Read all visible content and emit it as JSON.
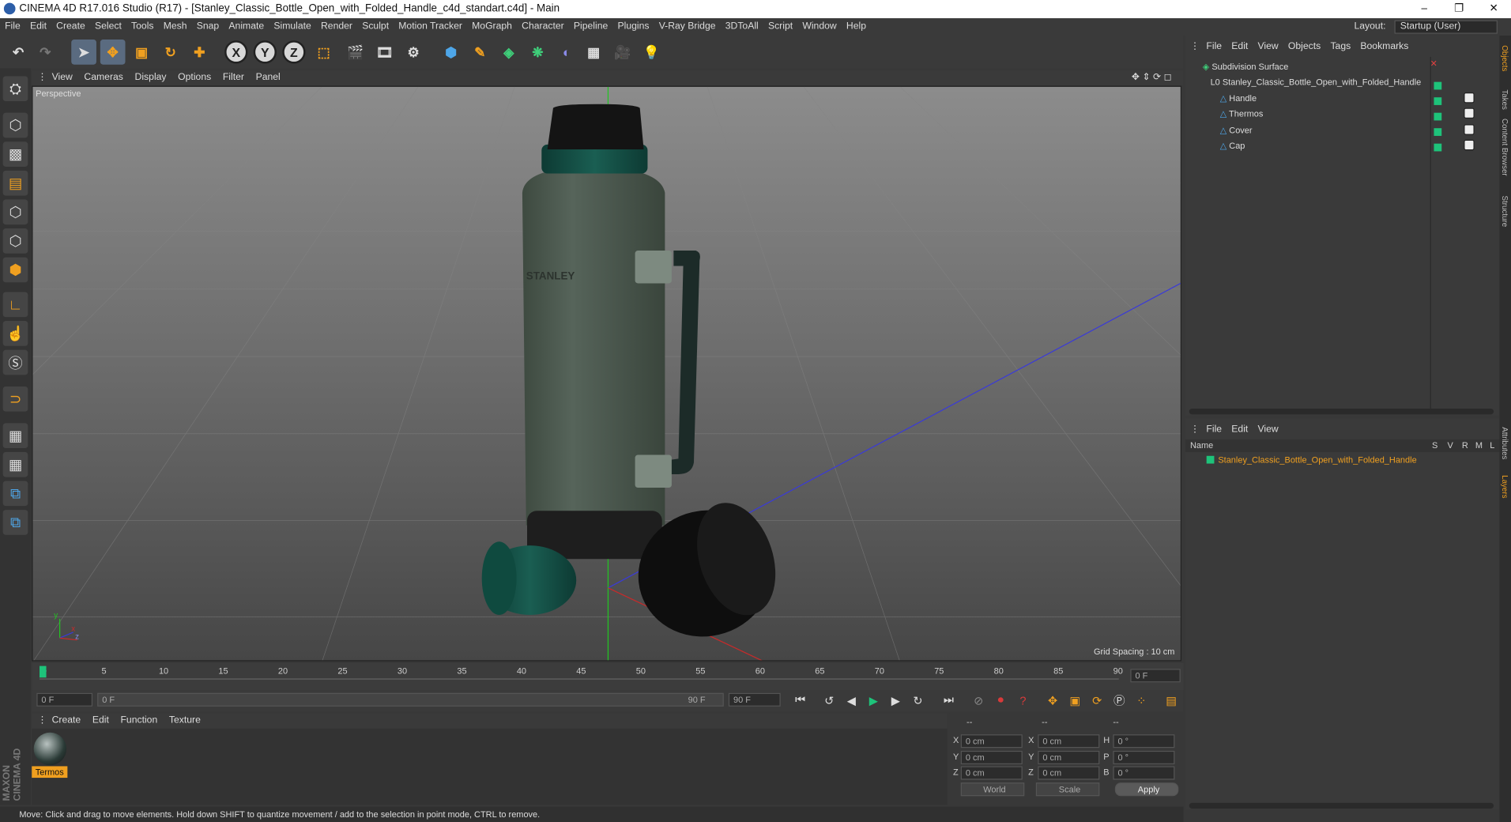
{
  "window": {
    "title": "CINEMA 4D R17.016 Studio (R17) - [Stanley_Classic_Bottle_Open_with_Folded_Handle_c4d_standart.c4d] - Main",
    "minimize": "–",
    "restore": "❐",
    "close": "✕"
  },
  "menu": [
    "File",
    "Edit",
    "Create",
    "Select",
    "Tools",
    "Mesh",
    "Snap",
    "Animate",
    "Simulate",
    "Render",
    "Sculpt",
    "Motion Tracker",
    "MoGraph",
    "Character",
    "Pipeline",
    "Plugins",
    "V-Ray Bridge",
    "3DToAll",
    "Script",
    "Window",
    "Help"
  ],
  "layout": {
    "label": "Layout:",
    "value": "Startup (User)"
  },
  "toolbar": {
    "x_label": "X",
    "y_label": "Y",
    "z_label": "Z"
  },
  "viewport": {
    "menu": [
      "View",
      "Cameras",
      "Display",
      "Options",
      "Filter",
      "Panel"
    ],
    "label": "Perspective",
    "grid_spacing": "Grid Spacing : 10 cm",
    "axis_y": "y",
    "axis_z": "z",
    "axis_x": "x"
  },
  "timeline": {
    "ticks": [
      "0",
      "5",
      "10",
      "15",
      "20",
      "25",
      "30",
      "35",
      "40",
      "45",
      "50",
      "55",
      "60",
      "65",
      "70",
      "75",
      "80",
      "85",
      "90"
    ],
    "current_frame": "0 F",
    "start_field": "0 F",
    "range_start": "0 F",
    "range_end": "90 F",
    "end_field": "90 F"
  },
  "material": {
    "menu": [
      "Create",
      "Edit",
      "Function",
      "Texture"
    ],
    "name": "Termos"
  },
  "attributes": {
    "header": [
      "--",
      "--",
      "--"
    ],
    "rows": [
      {
        "a": "X",
        "av": "0 cm",
        "b": "X",
        "bv": "0 cm",
        "c": "H",
        "cv": "0 °"
      },
      {
        "a": "Y",
        "av": "0 cm",
        "b": "Y",
        "bv": "0 cm",
        "c": "P",
        "cv": "0 °"
      },
      {
        "a": "Z",
        "av": "0 cm",
        "b": "Z",
        "bv": "0 cm",
        "c": "B",
        "cv": "0 °"
      }
    ],
    "coord_mode": "World",
    "size_mode": "Scale",
    "apply": "Apply"
  },
  "status": "Move: Click and drag to move elements. Hold down SHIFT to quantize movement / add to the selection in point mode, CTRL to remove.",
  "objects": {
    "menu": [
      "File",
      "Edit",
      "View",
      "Objects",
      "Tags",
      "Bookmarks"
    ],
    "items": [
      {
        "name": "Subdivision Surface"
      },
      {
        "name": "Stanley_Classic_Bottle_Open_with_Folded_Handle"
      },
      {
        "name": "Handle"
      },
      {
        "name": "Thermos"
      },
      {
        "name": "Cover"
      },
      {
        "name": "Cap"
      }
    ]
  },
  "layers": {
    "menu": [
      "File",
      "Edit",
      "View"
    ],
    "col_name": "Name",
    "cols": [
      "S",
      "V",
      "R",
      "M",
      "L"
    ],
    "item": "Stanley_Classic_Bottle_Open_with_Folded_Handle"
  },
  "side_tabs": [
    "Objects",
    "Takes",
    "Content Browser",
    "Structure"
  ],
  "side_tabs2": [
    "Attributes",
    "Layers"
  ],
  "brand": "MAXON CINEMA 4D",
  "colors": {
    "accent": "#1ec37a",
    "selection": "#f0a020",
    "bg": "#383838"
  }
}
